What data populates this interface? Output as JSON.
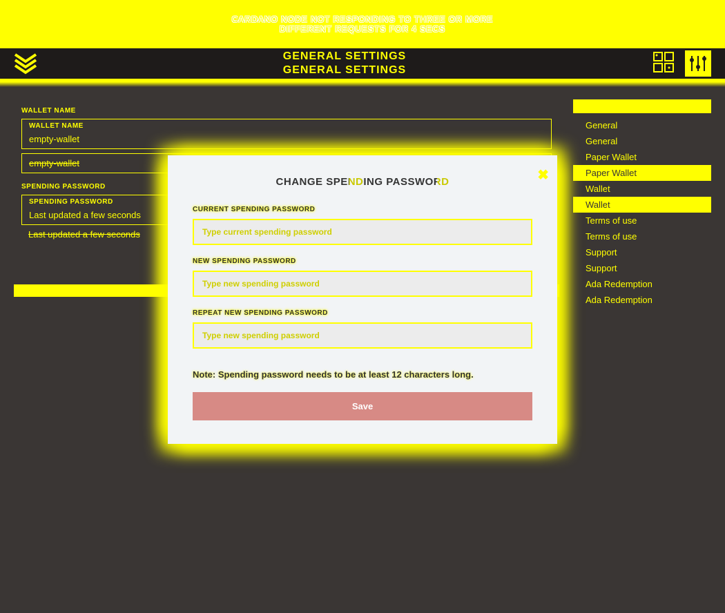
{
  "banner": {
    "line1": "CARDANO NODE NOT RESPONDING TO THREE OR MORE",
    "line2": "DIFFERENT REQUESTS FOR 4 SECS"
  },
  "header": {
    "title": "GENERAL SETTINGS"
  },
  "wallet": {
    "name_label": "WALLET NAME",
    "name_value": "empty-wallet",
    "password_label": "SPENDING PASSWORD",
    "last_updated": "Last updated a few seconds"
  },
  "nav": {
    "items": [
      {
        "label": "General",
        "active": false
      },
      {
        "label": "General",
        "active": false
      },
      {
        "label": "Paper Wallet",
        "active": false
      },
      {
        "label": "Paper Wallet",
        "active": true
      },
      {
        "label": "Wallet",
        "active": false
      },
      {
        "label": "Wallet",
        "active": true
      },
      {
        "label": "Terms of use",
        "active": false
      },
      {
        "label": "Terms of use",
        "active": false
      },
      {
        "label": "Support",
        "active": false
      },
      {
        "label": "Support",
        "active": false
      },
      {
        "label": "Ada Redemption",
        "active": false
      },
      {
        "label": "Ada Redemption",
        "active": false
      }
    ]
  },
  "modal": {
    "title": "CHANGE SPENDING PASSWORD",
    "close": "X",
    "current_label": "CURRENT SPENDING PASSWORD",
    "current_placeholder": "Type current spending password",
    "new_label": "NEW SPENDING PASSWORD",
    "new_placeholder": "Type new spending password",
    "repeat_label": "REPEAT NEW SPENDING PASSWORD",
    "repeat_placeholder": "Type new spending password",
    "note": "Note: Spending password needs to be at least 12 characters long.",
    "save": "Save"
  },
  "chart_data": null
}
